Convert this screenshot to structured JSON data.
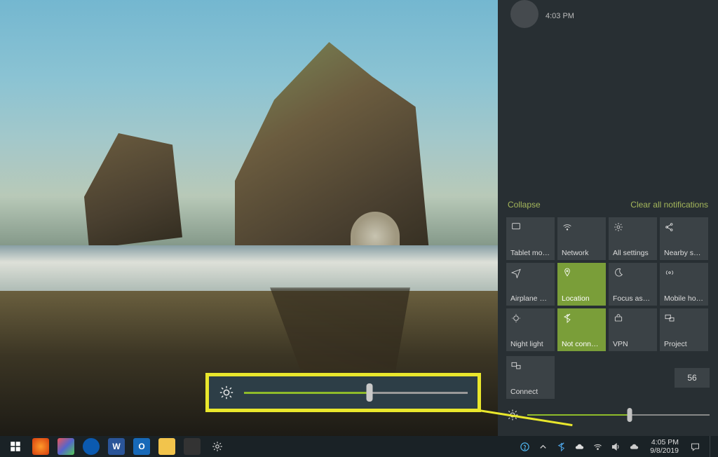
{
  "notification": {
    "time": "4:03 PM"
  },
  "action_center": {
    "collapse": "Collapse",
    "clear_all": "Clear all notifications",
    "tiles": [
      {
        "label": "Tablet mode",
        "active": false
      },
      {
        "label": "Network",
        "active": false
      },
      {
        "label": "All settings",
        "active": false
      },
      {
        "label": "Nearby sharing",
        "active": false
      },
      {
        "label": "Airplane mode",
        "active": false
      },
      {
        "label": "Location",
        "active": true
      },
      {
        "label": "Focus assist",
        "active": false
      },
      {
        "label": "Mobile hotspot",
        "active": false
      },
      {
        "label": "Night light",
        "active": false
      },
      {
        "label": "Not connected",
        "active": true
      },
      {
        "label": "VPN",
        "active": false
      },
      {
        "label": "Project",
        "active": false
      }
    ],
    "connect_tile": "Connect",
    "brightness_value": "56"
  },
  "callout": {
    "slider_percent": 56
  },
  "taskbar": {
    "time": "4:05 PM",
    "date": "9/8/2019"
  }
}
